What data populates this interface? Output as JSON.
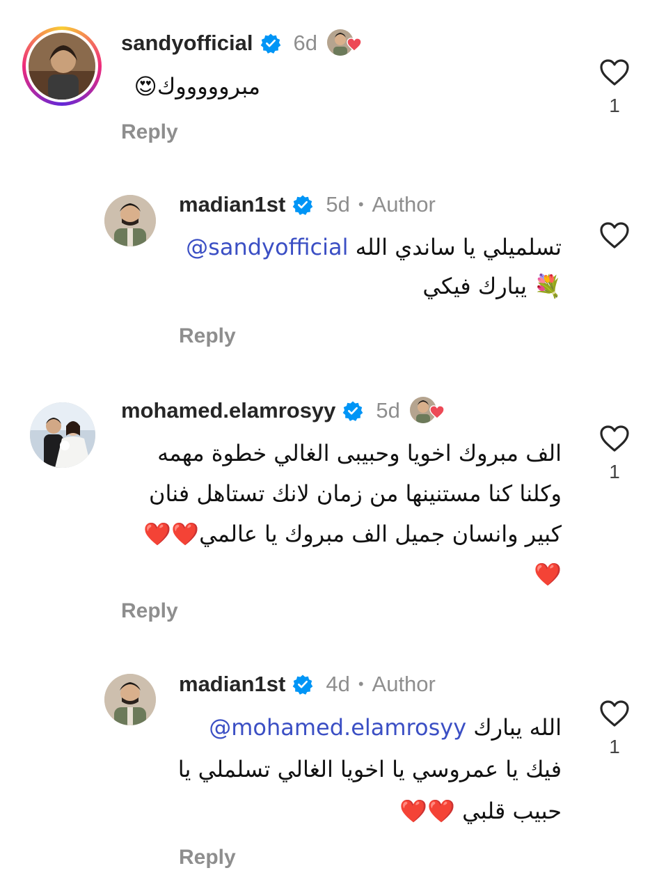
{
  "comments": [
    {
      "username": "sandyofficial",
      "time": "6d",
      "author_label": "",
      "lines": [
        "مبروووووك😍"
      ],
      "reply_label": "Reply",
      "likes": "1",
      "liked_by_author": true
    },
    {
      "username": "madian1st",
      "time": "5d",
      "author_label": "Author",
      "mention": "@sandyofficial",
      "lines": [
        "تسلميلي يا ساندي الله",
        "💐 يبارك فيكي"
      ],
      "reply_label": "Reply",
      "likes": ""
    },
    {
      "username": "mohamed.elamrosyy",
      "time": "5d",
      "author_label": "",
      "lines": [
        "الف مبروك اخويا وحبيبى الغالي خطوة مهمه",
        "وكلنا كنا مستنينها من زمان لانك تستاهل فنان",
        "كبير وانسان جميل الف مبروك يا عالمي❤️❤️",
        "❤️"
      ],
      "reply_label": "Reply",
      "likes": "1",
      "liked_by_author": true
    },
    {
      "username": "madian1st",
      "time": "4d",
      "author_label": "Author",
      "mention": "@mohamed.elamrosyy",
      "lines": [
        "الله يبارك",
        "فيك يا عمروسي يا اخويا الغالي تسلملي يا",
        "حبيب قلبي ❤️❤️"
      ],
      "reply_label": "Reply",
      "likes": "1"
    }
  ],
  "separator": "•",
  "icons": {
    "verified": "verified-badge-icon",
    "like": "heart-outline-icon",
    "liked_by_author": "author-liked-heart-icon"
  },
  "colors": {
    "verified": "#0095f6",
    "mention": "#3b4fc4",
    "muted": "#8e8e8e",
    "heart": "#ed4956"
  }
}
